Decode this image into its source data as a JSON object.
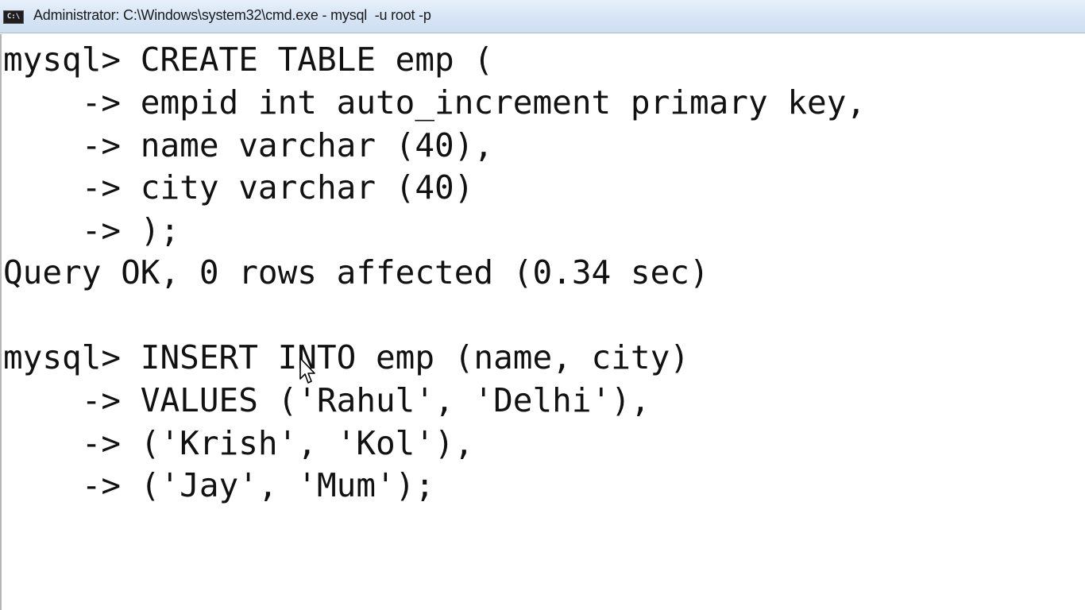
{
  "window": {
    "title": "Administrator: C:\\Windows\\system32\\cmd.exe - mysql  -u root -p",
    "icon_label": "C:\\",
    "icon": "console-icon"
  },
  "console": {
    "lines": [
      "mysql> CREATE TABLE emp (",
      "    -> empid int auto_increment primary key,",
      "    -> name varchar (40),",
      "    -> city varchar (40)",
      "    -> );",
      "Query OK, 0 rows affected (0.34 sec)",
      "",
      "mysql> INSERT INTO emp (name, city)",
      "    -> VALUES ('Rahul', 'Delhi'),",
      "    -> ('Krish', 'Kol'),",
      "    -> ('Jay', 'Mum');"
    ]
  },
  "pointer": {
    "icon": "mouse-pointer-icon"
  }
}
